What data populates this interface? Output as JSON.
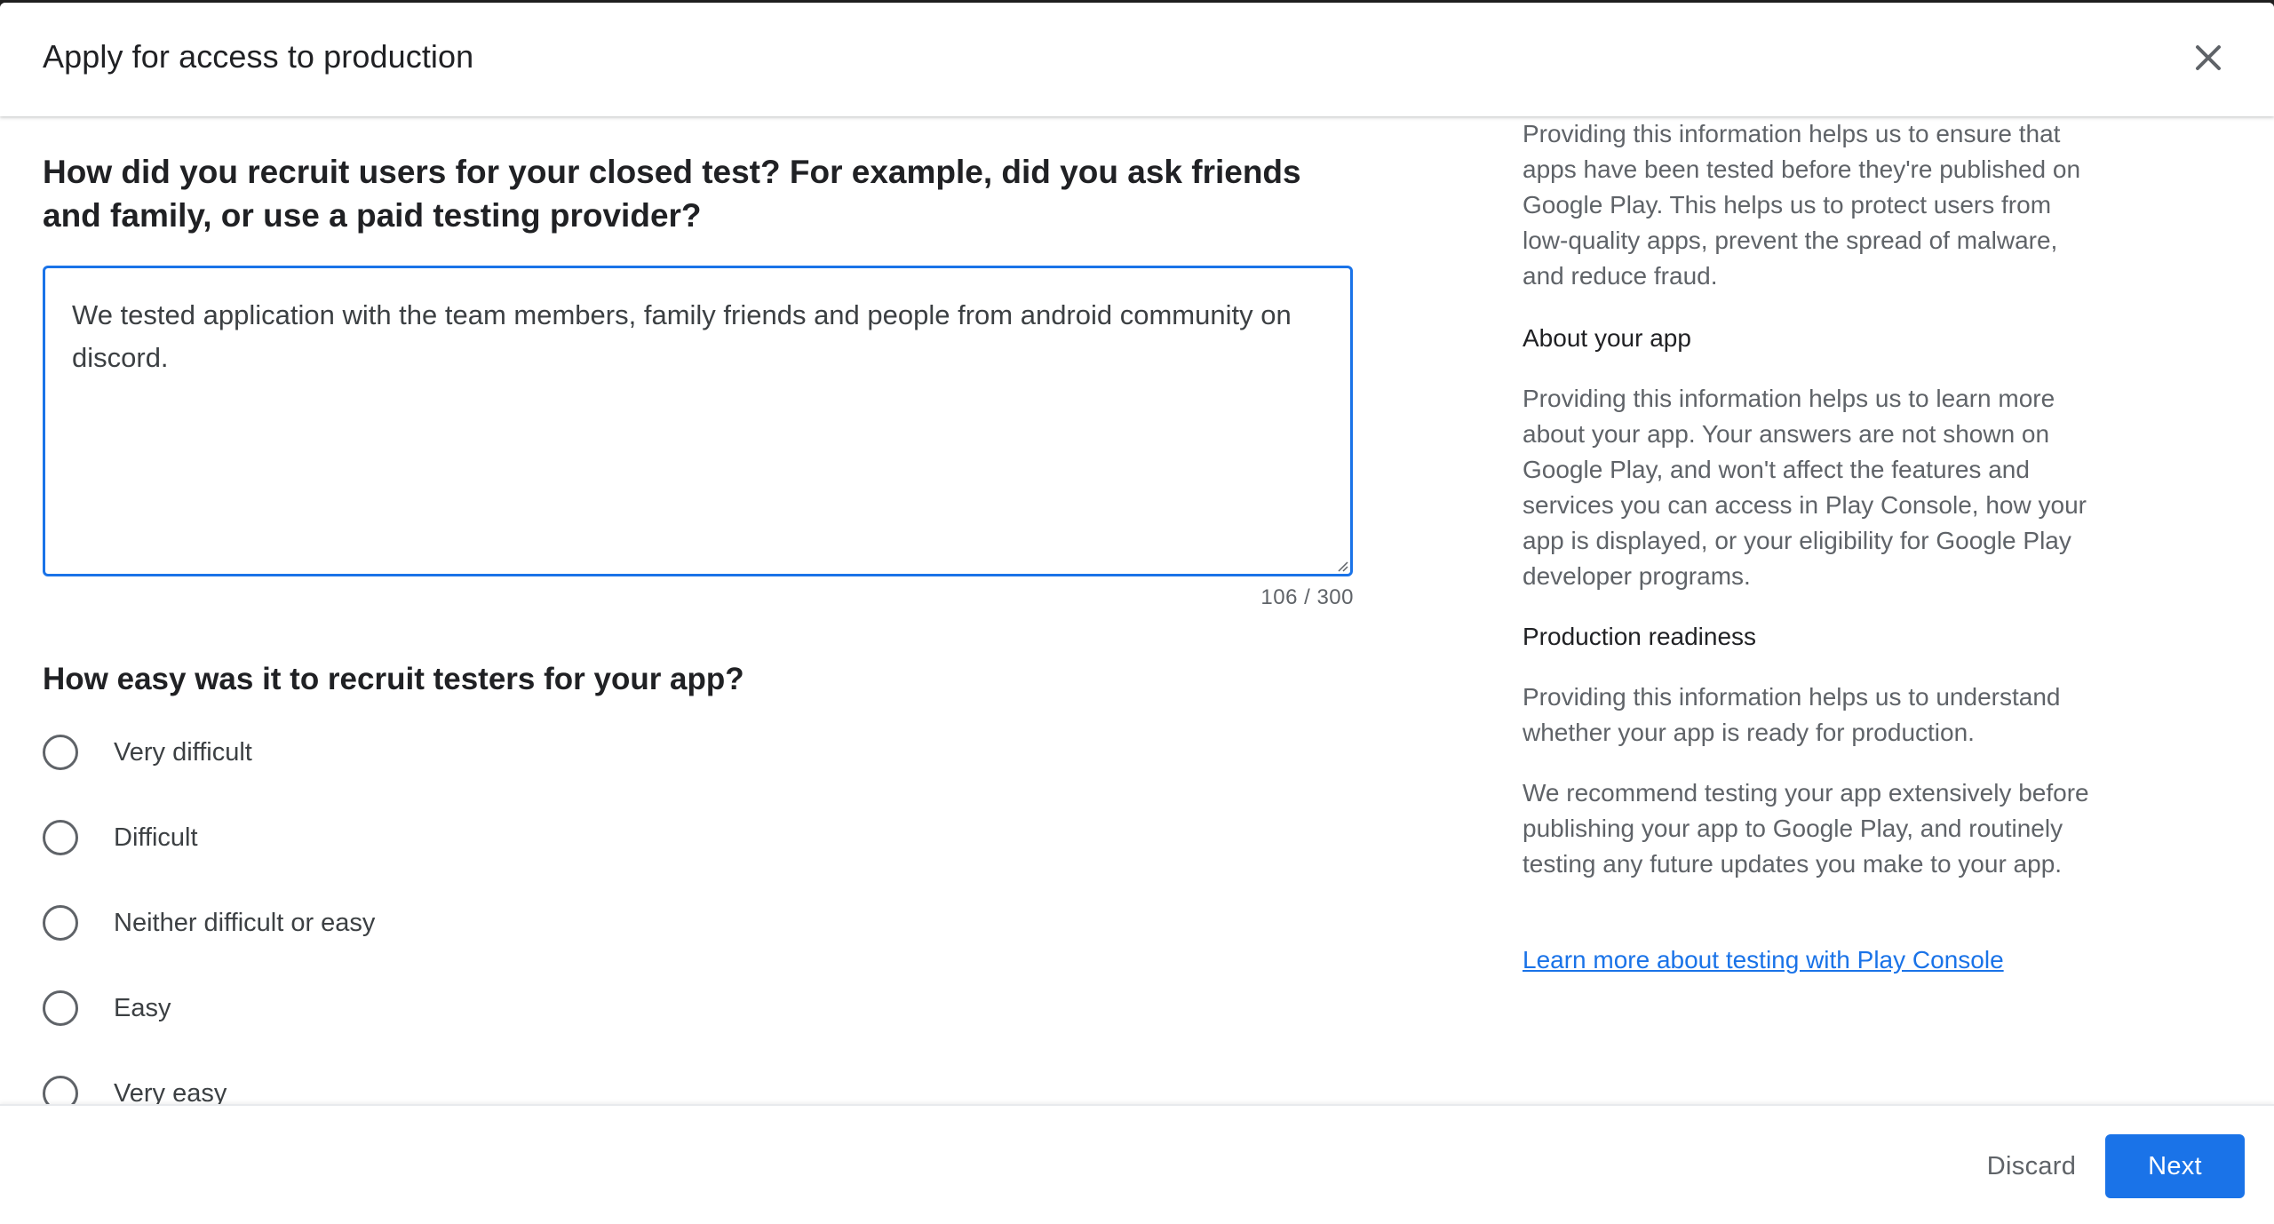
{
  "dialog": {
    "title": "Apply for access to production"
  },
  "form": {
    "recruit_question": "How did you recruit users for your closed test? For example, did you ask friends and family, or use a paid testing provider?",
    "recruit_answer": "We tested application with the team members, family friends and people from android community on discord.",
    "char_counter": "106 / 300",
    "ease_question": "How easy was it to recruit testers for your app?",
    "ease_options": [
      {
        "label": "Very difficult"
      },
      {
        "label": "Difficult"
      },
      {
        "label": "Neither difficult or easy"
      },
      {
        "label": "Easy"
      },
      {
        "label": "Very easy"
      }
    ]
  },
  "sidebar": {
    "intro_text": "Providing this information helps us to ensure that apps have been tested before they're published on Google Play. This helps us to protect users from low-quality apps, prevent the spread of malware, and reduce fraud.",
    "about_heading": "About your app",
    "about_text": "Providing this information helps us to learn more about your app. Your answers are not shown on Google Play, and won't affect the features and services you can access in Play Console, how your app is displayed, or your eligibility for Google Play developer programs.",
    "readiness_heading": "Production readiness",
    "readiness_text": "Providing this information helps us to understand whether your app is ready for production.",
    "recommend_text": "We recommend testing your app extensively before publishing your app to Google Play, and routinely testing any future updates you make to your app.",
    "learn_more_link": "Learn more about testing with Play Console"
  },
  "footer": {
    "discard_label": "Discard",
    "next_label": "Next"
  },
  "colors": {
    "accent": "#1a73e8",
    "text_primary": "#202124",
    "text_secondary": "#5f6368"
  }
}
